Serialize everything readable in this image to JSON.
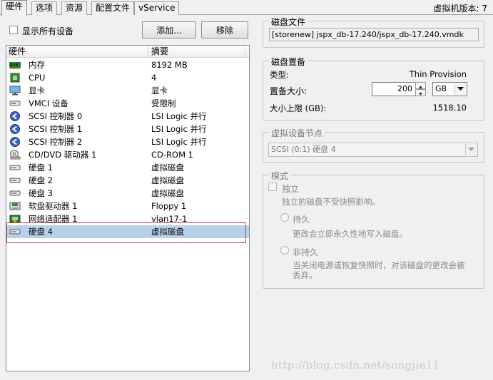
{
  "tabs": [
    {
      "label": "硬件",
      "active": true
    },
    {
      "label": "选项"
    },
    {
      "label": "资源"
    },
    {
      "label": "配置文件"
    },
    {
      "label": "vService"
    }
  ],
  "version_label": "虚拟机版本: 7",
  "left": {
    "show_all_label": "显示所有设备",
    "show_all_checked": false,
    "add_button": "添加...",
    "remove_button": "移除",
    "columns": [
      "硬件",
      "摘要"
    ],
    "rows": [
      {
        "name": "内存",
        "summary": "8192 MB",
        "icon": "memory-icon"
      },
      {
        "name": "CPU",
        "summary": "4",
        "icon": "cpu-icon"
      },
      {
        "name": "显卡",
        "summary": "显卡",
        "icon": "display-icon"
      },
      {
        "name": "VMCI 设备",
        "summary": "受限制",
        "icon": "vmci-icon"
      },
      {
        "name": "SCSI 控制器  0",
        "summary": "LSI Logic 并行",
        "icon": "scsi-icon"
      },
      {
        "name": "SCSI 控制器  1",
        "summary": "LSI Logic 并行",
        "icon": "scsi-icon"
      },
      {
        "name": "SCSI 控制器  2",
        "summary": "LSI Logic 并行",
        "icon": "scsi-icon"
      },
      {
        "name": "CD/DVD 驱动器  1",
        "summary": "CD-ROM 1",
        "icon": "cdrom-icon"
      },
      {
        "name": "硬盘  1",
        "summary": "虚拟磁盘",
        "icon": "disk-icon"
      },
      {
        "name": "硬盘  2",
        "summary": "虚拟磁盘",
        "icon": "disk-icon"
      },
      {
        "name": "硬盘  3",
        "summary": "虚拟磁盘",
        "icon": "disk-icon"
      },
      {
        "name": "软盘驱动器  1",
        "summary": "Floppy 1",
        "icon": "floppy-icon"
      },
      {
        "name": "网络适配器  1",
        "summary": "vlan17-1",
        "icon": "network-icon"
      },
      {
        "name": "硬盘  4",
        "summary": "虚拟磁盘",
        "icon": "disk-icon",
        "selected": true
      }
    ]
  },
  "right": {
    "disk_file": {
      "title": "磁盘文件",
      "value": "[storenew] jspx_db-17.240/jspx_db-17.240.vmdk"
    },
    "provision": {
      "title": "磁盘置备",
      "type_label": "类型:",
      "type_value": "Thin Provision",
      "size_label": "置备大小:",
      "size_value": "200",
      "unit_value": "GB",
      "max_label": "大小上限 (GB):",
      "max_value": "1518.10"
    },
    "vdn": {
      "title": "虚拟设备节点",
      "value": "SCSI (0:1) 硬盘 4"
    },
    "mode": {
      "title": "模式",
      "independent_label": "独立",
      "independent_desc": "独立的磁盘不受快照影响。",
      "persistent_label": "持久",
      "persistent_desc": "更改会立即永久性地写入磁盘。",
      "nonpersistent_label": "非持久",
      "nonpersistent_desc_1": "当关闭电源或恢复快照时，对该磁盘的更改会被",
      "nonpersistent_desc_2": "丢弃。"
    }
  },
  "watermark": "http://blog.csdn.net/songjie11"
}
